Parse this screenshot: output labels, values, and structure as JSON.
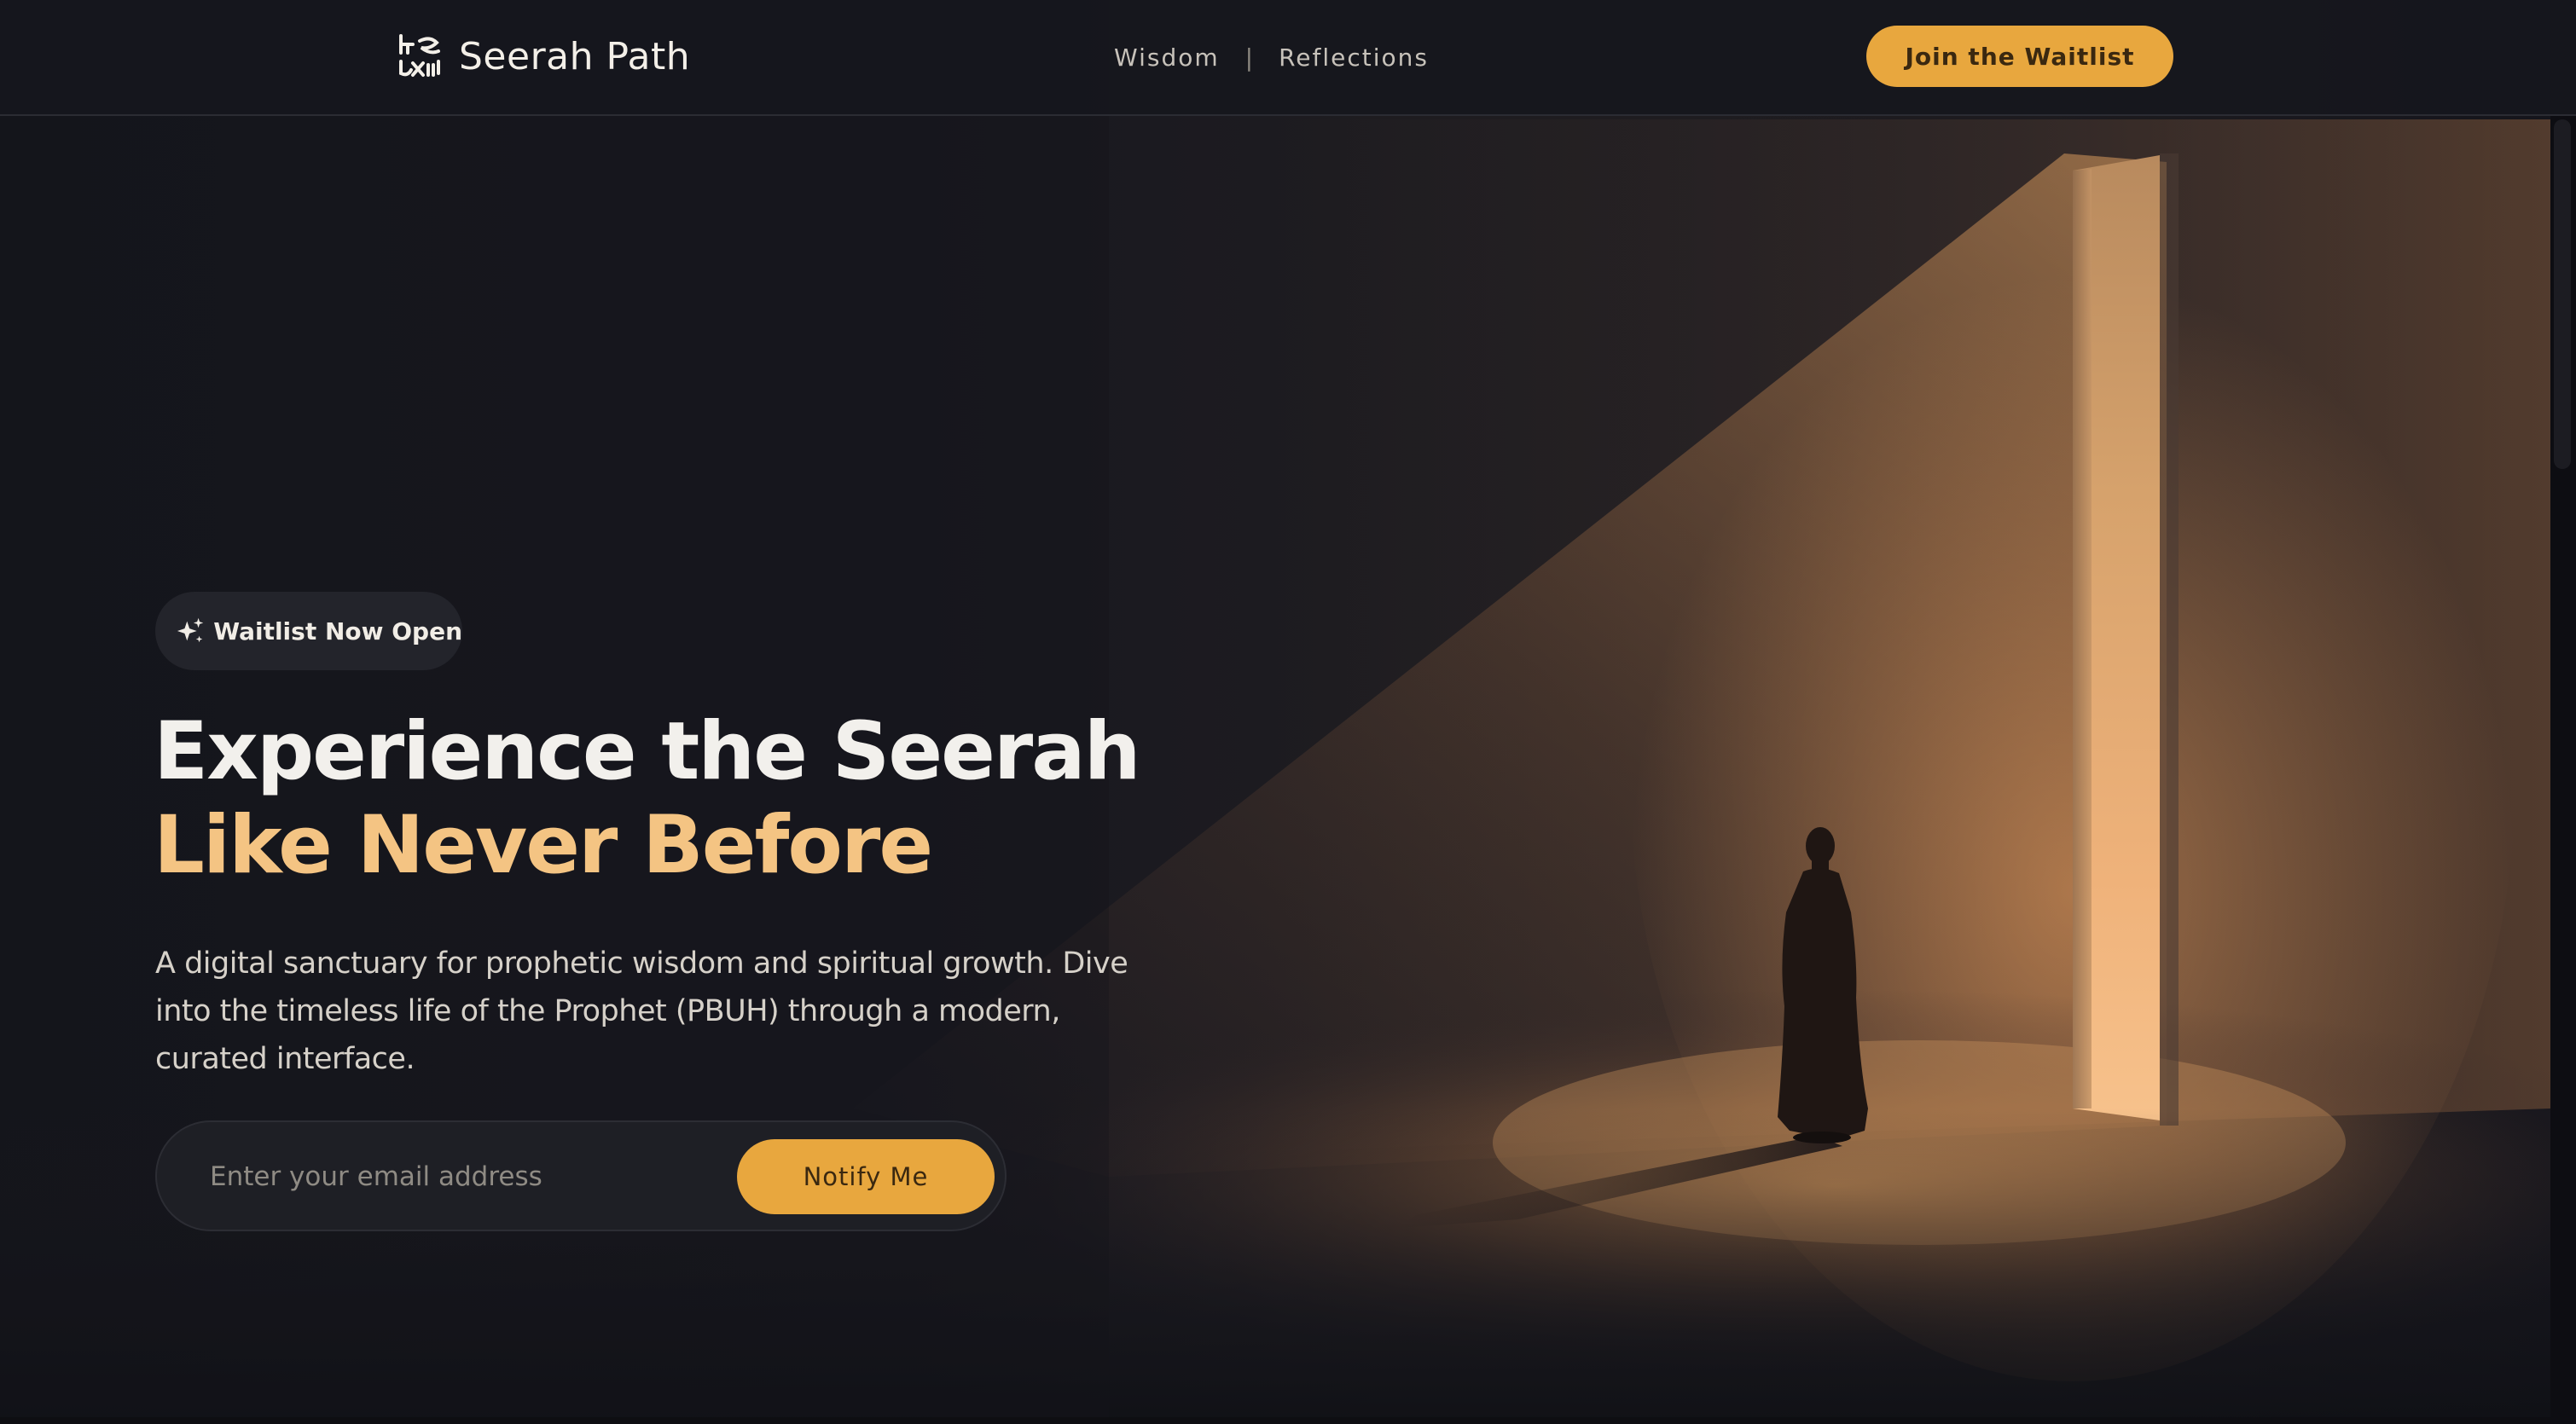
{
  "nav": {
    "brand": "Seerah Path",
    "links": [
      "Wisdom",
      "Reflections"
    ],
    "separator": "|",
    "cta_label": "Join the Waitlist"
  },
  "hero": {
    "badge": "Waitlist Now Open",
    "title_line_1": "Experience the Seerah",
    "title_line_2": "Like Never Before",
    "description": "A digital sanctuary for prophetic wisdom and spiritual growth. Dive into the timeless life of the Prophet (PBUH) through a modern, curated interface.",
    "email_placeholder": "Enter your email address",
    "notify_label": "Notify Me"
  },
  "icons": {
    "logo": "seerah-logo-icon",
    "badge": "sparkles-icon"
  },
  "colors": {
    "accent": "#e8a73e",
    "title_highlight": "#f4c483",
    "background": "#15161d",
    "nav_background": "#16171d",
    "badge_background": "#23242b"
  }
}
